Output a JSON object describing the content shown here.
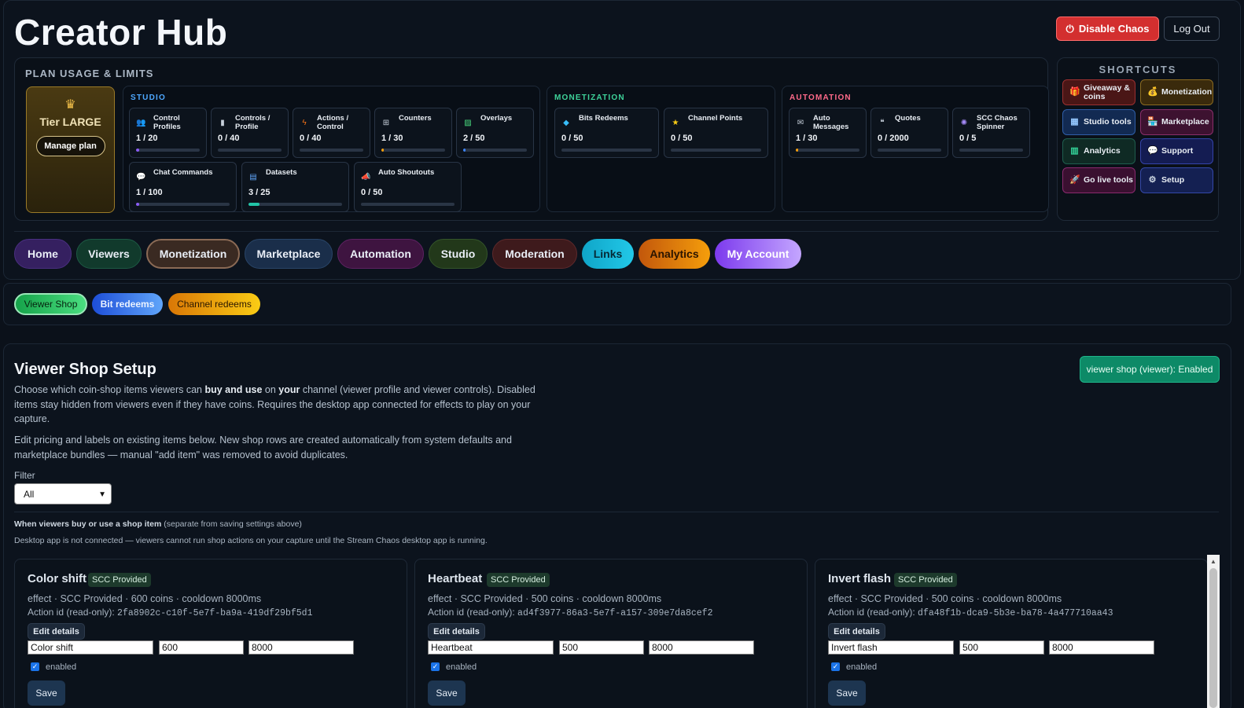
{
  "header": {
    "title": "Creator Hub",
    "disable_chaos": "Disable Chaos",
    "logout": "Log Out"
  },
  "plan": {
    "heading": "PLAN USAGE & LIMITS",
    "tier": {
      "name": "Tier LARGE",
      "manage": "Manage plan"
    },
    "groups": {
      "studio": {
        "label": "STUDIO",
        "color": "#4ea8ff"
      },
      "monetization": {
        "label": "MONETIZATION",
        "color": "#3ed39a"
      },
      "automation": {
        "label": "AUTOMATION",
        "color": "#ff6a8a"
      }
    },
    "cards": {
      "control_profiles": {
        "name": "Control Profiles",
        "count": "1 / 20",
        "fill": 0.05,
        "color": "#8b5cf6"
      },
      "controls_per_profile": {
        "name": "Controls / Profile",
        "count": "0 / 40",
        "fill": 0,
        "color": "#8b5cf6"
      },
      "actions_per_control": {
        "name": "Actions / Control",
        "count": "0 / 40",
        "fill": 0,
        "color": "#8b5cf6"
      },
      "counters": {
        "name": "Counters",
        "count": "1 / 30",
        "fill": 0.033,
        "color": "#f59e0b"
      },
      "overlays": {
        "name": "Overlays",
        "count": "2 / 50",
        "fill": 0.04,
        "color": "#3b82f6"
      },
      "chat_commands": {
        "name": "Chat Commands",
        "count": "1 / 100",
        "fill": 0.01,
        "color": "#8b5cf6"
      },
      "datasets": {
        "name": "Datasets",
        "count": "3 / 25",
        "fill": 0.12,
        "color": "#22c5a8"
      },
      "auto_shoutouts": {
        "name": "Auto Shoutouts",
        "count": "0 / 50",
        "fill": 0,
        "color": "#8b5cf6"
      },
      "bits_redeems": {
        "name": "Bits Redeems",
        "count": "0 / 50",
        "fill": 0,
        "color": "#8b5cf6"
      },
      "channel_points": {
        "name": "Channel Points",
        "count": "0 / 50",
        "fill": 0,
        "color": "#8b5cf6"
      },
      "auto_messages": {
        "name": "Auto Messages",
        "count": "1 / 30",
        "fill": 0.033,
        "color": "#f59e0b"
      },
      "quotes": {
        "name": "Quotes",
        "count": "0 / 2000",
        "fill": 0,
        "color": "#8b5cf6"
      },
      "scc_spinner": {
        "name": "SCC Chaos Spinner",
        "count": "0 / 5",
        "fill": 0,
        "color": "#8b5cf6"
      }
    }
  },
  "shortcuts": {
    "heading": "SHORTCUTS",
    "items": [
      {
        "label": "Giveaway & coins",
        "icon": "gift-icon"
      },
      {
        "label": "Monetization",
        "icon": "money-bag-icon"
      },
      {
        "label": "Studio tools",
        "icon": "studio-icon"
      },
      {
        "label": "Marketplace",
        "icon": "store-icon"
      },
      {
        "label": "Analytics",
        "icon": "chart-icon"
      },
      {
        "label": "Support",
        "icon": "chat-bubble-icon"
      },
      {
        "label": "Go live tools",
        "icon": "rocket-icon"
      },
      {
        "label": "Setup",
        "icon": "gear-icon"
      }
    ]
  },
  "tabs": [
    "Home",
    "Viewers",
    "Monetization",
    "Marketplace",
    "Automation",
    "Studio",
    "Moderation",
    "Links",
    "Analytics",
    "My Account"
  ],
  "subtabs": [
    "Viewer Shop",
    "Bit redeems",
    "Channel redeems"
  ],
  "shop": {
    "title": "Viewer Shop Setup",
    "status": "viewer shop (viewer): Enabled",
    "desc1_a": "Choose which coin-shop items viewers can ",
    "desc1_b": "buy and use",
    "desc1_c": " on ",
    "desc1_d": "your",
    "desc1_e": " channel (viewer profile and viewer controls). Disabled items stay hidden from viewers even if they have coins. Requires the desktop app connected for effects to play on your capture.",
    "desc2": "Edit pricing and labels on existing items below. New shop rows are created automatically from system defaults and marketplace bundles — manual \"add item\" was removed to avoid duplicates.",
    "filter_label": "Filter",
    "filter_value": "All",
    "note_bold": "When viewers buy or use a shop item",
    "note_rest": " (separate from saving settings above)",
    "note2": "Desktop app is not connected — viewers cannot run shop actions on your capture until the Stream Chaos desktop app is running.",
    "items": [
      {
        "title": "Color shift",
        "badge": "SCC Provided",
        "meta": "effect · SCC Provided · 600 coins · cooldown 8000ms",
        "aid_label": "Action id (read-only): ",
        "aid": "2fa8902c-c10f-5e7f-ba9a-419df29bf5d1",
        "edit": "Edit details",
        "name": "Color shift",
        "price": "600",
        "cooldown": "8000",
        "enabled": "enabled",
        "save": "Save"
      },
      {
        "title": "Heartbeat",
        "badge": "SCC Provided",
        "meta": "effect · SCC Provided · 500 coins · cooldown 8000ms",
        "aid_label": "Action id (read-only): ",
        "aid": "ad4f3977-86a3-5e7f-a157-309e7da8cef2",
        "edit": "Edit details",
        "name": "Heartbeat",
        "price": "500",
        "cooldown": "8000",
        "enabled": "enabled",
        "save": "Save"
      },
      {
        "title": "Invert flash",
        "badge": "SCC Provided",
        "meta": "effect · SCC Provided · 500 coins · cooldown 8000ms",
        "aid_label": "Action id (read-only): ",
        "aid": "dfa48f1b-dca9-5b3e-ba78-4a477710aa43",
        "edit": "Edit details",
        "name": "Invert flash",
        "price": "500",
        "cooldown": "8000",
        "enabled": "enabled",
        "save": "Save"
      }
    ]
  }
}
